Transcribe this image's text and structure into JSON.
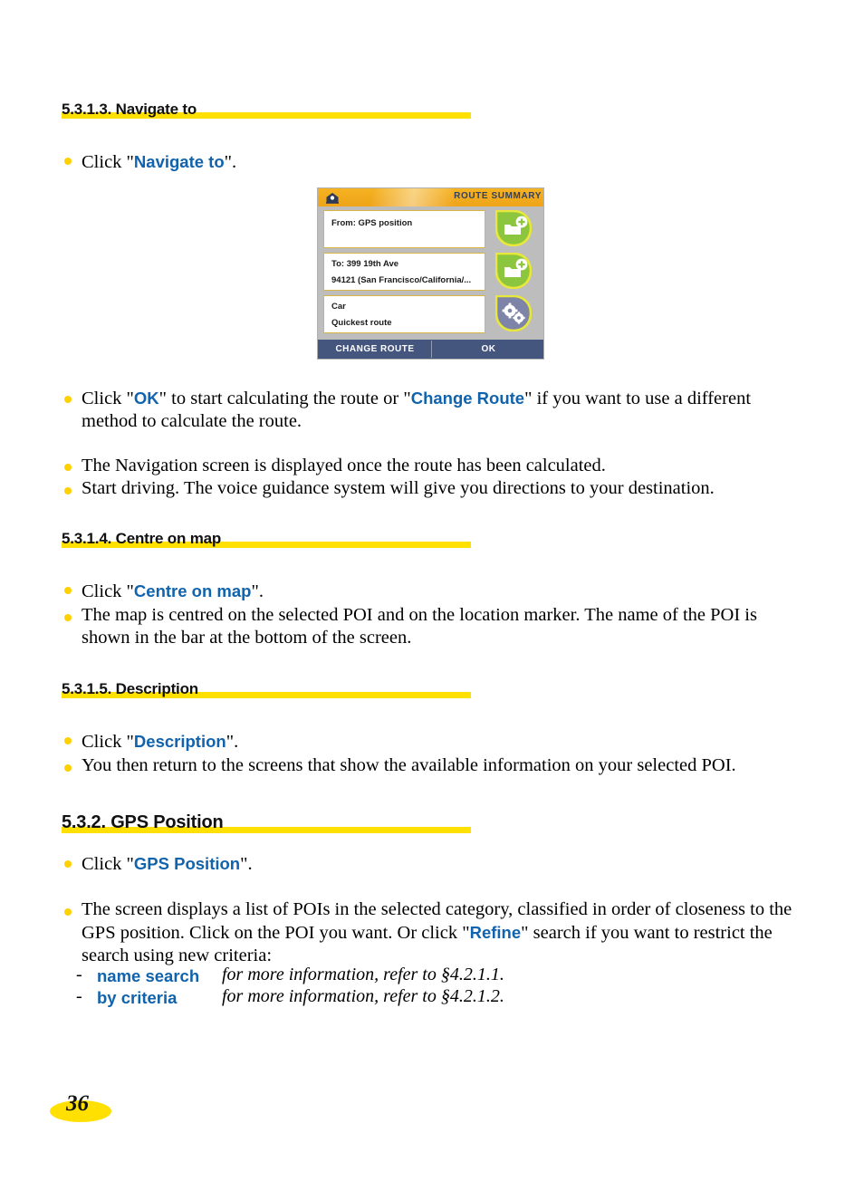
{
  "document": {
    "page_number": "36"
  },
  "sections": [
    {
      "id": "navigate-to",
      "heading": "5.3.1.3. Navigate to",
      "bullets": [
        {
          "parts": [
            {
              "t": "Click \"",
              "style": "plain"
            },
            {
              "t": "Navigate to",
              "style": "kw"
            },
            {
              "t": "\".",
              "style": "plain"
            }
          ]
        }
      ]
    },
    {
      "id": "navigate-to-after",
      "bullets": [
        {
          "parts": [
            {
              "t": "Click \"",
              "style": "plain"
            },
            {
              "t": "OK",
              "style": "kw"
            },
            {
              "t": "\" to start calculating the route or \"",
              "style": "plain"
            },
            {
              "t": "Change Route",
              "style": "kw"
            },
            {
              "t": "\" if you want to use a different method to calculate the route.",
              "style": "plain"
            }
          ]
        },
        {
          "parts": [
            {
              "t": "The Navigation screen is displayed once the route has been calculated.",
              "style": "plain"
            }
          ]
        },
        {
          "parts": [
            {
              "t": "Start driving. The voice guidance system will give you directions to your destination.",
              "style": "plain"
            }
          ]
        }
      ]
    },
    {
      "id": "centre-on-map",
      "heading": "5.3.1.4. Centre on map",
      "bullets": [
        {
          "parts": [
            {
              "t": "Click \"",
              "style": "plain"
            },
            {
              "t": "Centre on map",
              "style": "kw"
            },
            {
              "t": "\".",
              "style": "plain"
            }
          ]
        },
        {
          "parts": [
            {
              "t": "The map is centred on the selected POI and on the location marker. The name of the POI is shown in the bar at the bottom of the screen.",
              "style": "plain"
            }
          ]
        }
      ]
    },
    {
      "id": "description",
      "heading": "5.3.1.5. Description",
      "bullets": [
        {
          "parts": [
            {
              "t": "Click \"",
              "style": "plain"
            },
            {
              "t": "Description",
              "style": "kw"
            },
            {
              "t": "\".",
              "style": "plain"
            }
          ]
        },
        {
          "parts": [
            {
              "t": "You then return to the screens that show the available information on your selected POI.",
              "style": "plain"
            }
          ]
        }
      ]
    },
    {
      "id": "gps-position",
      "heading": "5.3.2. GPS Position",
      "bullets": [
        {
          "parts": [
            {
              "t": "Click \"",
              "style": "plain"
            },
            {
              "t": "GPS Position",
              "style": "kw"
            },
            {
              "t": "\".",
              "style": "plain"
            }
          ]
        },
        {
          "parts": [
            {
              "t": "The screen displays a list of POIs in the selected category, classified in order of closeness to the GPS position. Click on the POI you want. Or click \"",
              "style": "plain"
            },
            {
              "t": "Refine",
              "style": "kw"
            },
            {
              "t": "\" search if you want to restrict the search using new criteria:",
              "style": "plain"
            }
          ]
        }
      ],
      "subitems": [
        {
          "dash": "-",
          "label": "name search",
          "reference": "for more information, refer to §4.2.1.1."
        },
        {
          "dash": "-",
          "label": "by criteria",
          "reference": "for more information, refer to §4.2.1.2."
        }
      ]
    }
  ],
  "device_screenshot": {
    "title": "ROUTE SUMMARY",
    "home_icon": "home-icon",
    "fields": [
      {
        "lines": [
          "From: GPS position"
        ],
        "icon": "add-waypoint-start-icon"
      },
      {
        "lines": [
          "To: 399 19th Ave",
          "94121 (San Francisco/California/..."
        ],
        "icon": "add-waypoint-end-icon"
      },
      {
        "lines": [
          "Car",
          "Quickest route"
        ],
        "icon": "route-settings-gears-icon"
      }
    ],
    "buttons": [
      {
        "label": "CHANGE ROUTE"
      },
      {
        "label": "OK"
      }
    ],
    "colors": {
      "header": "#EFA41A",
      "footer": "#44557E",
      "body": "#BDBDBD",
      "icon_green": "#8CC63F",
      "icon_purple": "#7E84A8",
      "icon_outline": "#E8E83A"
    }
  },
  "theme": {
    "accent_yellow": "#FFE000",
    "bullet_yellow": "#FFD100",
    "keyword_blue": "#1063AC"
  }
}
